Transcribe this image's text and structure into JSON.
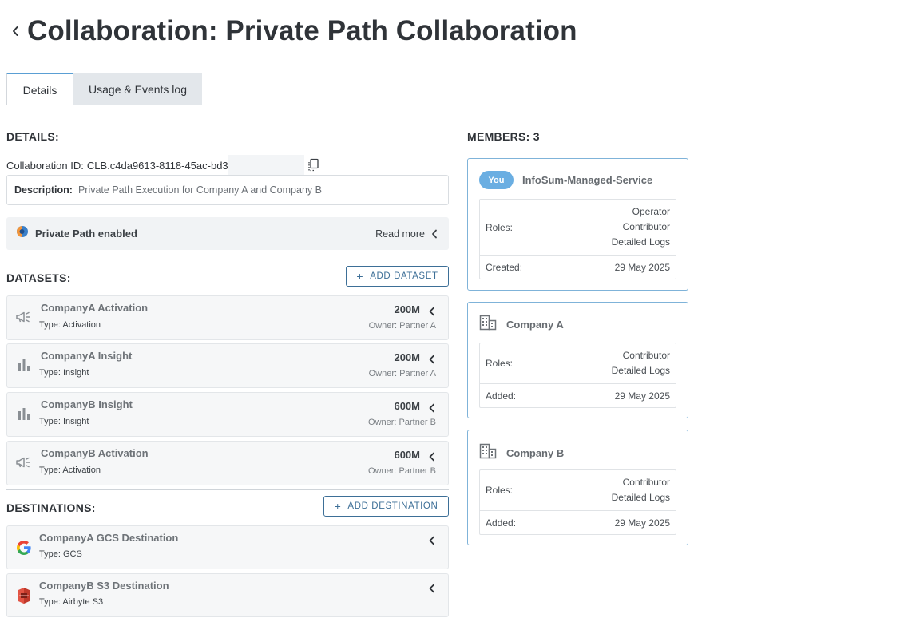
{
  "header": {
    "title": "Collaboration: Private Path Collaboration"
  },
  "tabs": [
    {
      "label": "Details",
      "active": true
    },
    {
      "label": "Usage & Events log",
      "active": false
    }
  ],
  "details": {
    "section_title": "DETAILS:",
    "collab_id_label": "Collaboration ID:",
    "collab_id_value": "CLB.c4da9613-8118-45ac-bd3",
    "description_label": "Description:",
    "description_value": "Private Path Execution for Company A and Company B",
    "private_path_label": "Private Path enabled",
    "read_more": "Read more"
  },
  "datasets": {
    "section_title": "DATASETS:",
    "add_label": "ADD DATASET",
    "items": [
      {
        "name": "CompanyA Activation",
        "type": "Type: Activation",
        "size": "200M",
        "owner": "Owner: Partner A",
        "icon": "megaphone-icon"
      },
      {
        "name": "CompanyA Insight",
        "type": "Type: Insight",
        "size": "200M",
        "owner": "Owner: Partner A",
        "icon": "bar-chart-icon"
      },
      {
        "name": "CompanyB Insight",
        "type": "Type: Insight",
        "size": "600M",
        "owner": "Owner: Partner B",
        "icon": "bar-chart-icon"
      },
      {
        "name": "CompanyB Activation",
        "type": "Type: Activation",
        "size": "600M",
        "owner": "Owner: Partner B",
        "icon": "megaphone-icon"
      }
    ]
  },
  "destinations": {
    "section_title": "DESTINATIONS:",
    "add_label": "ADD DESTINATION",
    "items": [
      {
        "name": "CompanyA GCS Destination",
        "type": "Type: GCS",
        "icon": "google-icon"
      },
      {
        "name": "CompanyB S3 Destination",
        "type": "Type: Airbyte S3",
        "icon": "aws-s3-icon"
      }
    ]
  },
  "members": {
    "section_title": "MEMBERS: 3",
    "roles_label": "Roles:",
    "items": [
      {
        "badge": "You",
        "name": "InfoSum-Managed-Service",
        "roles": [
          "Operator",
          "Contributor",
          "Detailed Logs"
        ],
        "date_label": "Created:",
        "date": "29 May 2025"
      },
      {
        "name": "Company A",
        "roles": [
          "Contributor",
          "Detailed Logs"
        ],
        "date_label": "Added:",
        "date": "29 May 2025",
        "icon": "building-icon"
      },
      {
        "name": "Company B",
        "roles": [
          "Contributor",
          "Detailed Logs"
        ],
        "date_label": "Added:",
        "date": "29 May 2025",
        "icon": "building-icon"
      }
    ]
  },
  "colors": {
    "accent": "#3d6f97",
    "member_border": "#7fb3d9",
    "you_badge": "#6aaee2"
  }
}
